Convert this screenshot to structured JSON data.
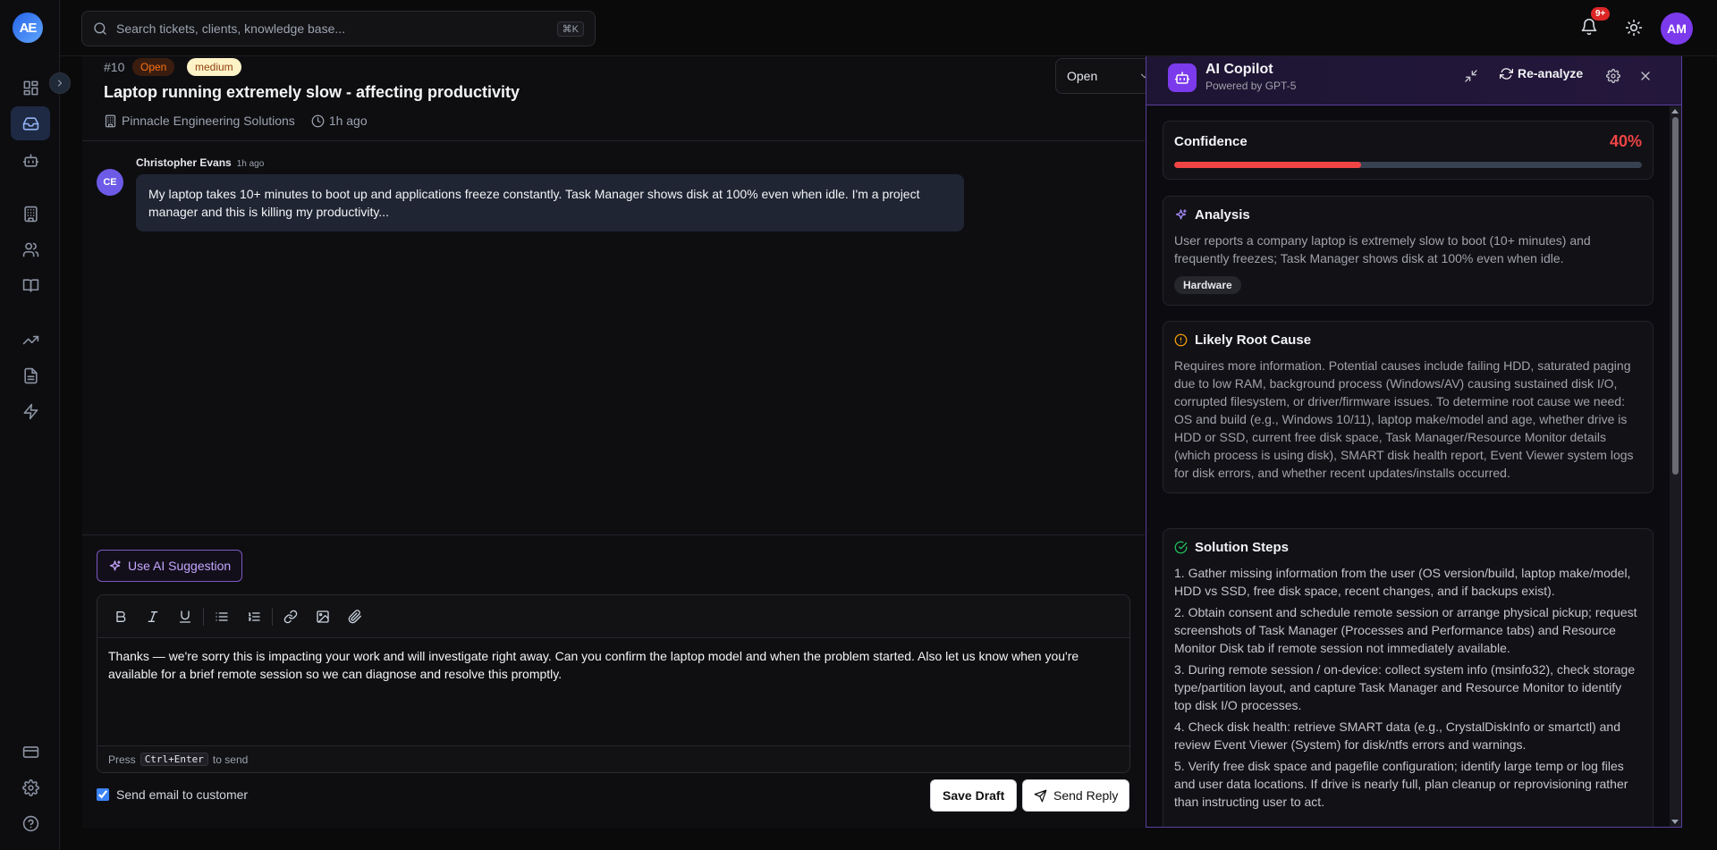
{
  "app": {
    "logo_text": "AE"
  },
  "search": {
    "placeholder": "Search tickets, clients, knowledge base...",
    "shortcut": "⌘K"
  },
  "header": {
    "notifications_badge": "9+",
    "user_initials": "AM"
  },
  "rail": {
    "items": [
      "dashboard-icon",
      "inbox-icon",
      "bot-icon",
      "building-icon",
      "users-icon",
      "book-icon",
      "trending-icon",
      "document-icon",
      "bolt-icon"
    ],
    "bottom": [
      "card-icon",
      "settings-icon",
      "help-icon"
    ]
  },
  "ticket": {
    "number": "#10",
    "status_badge": "Open",
    "priority_badge": "medium",
    "title": "Laptop running extremely slow - affecting productivity",
    "company": "Pinnacle Engineering Solutions",
    "age": "1h ago",
    "status_select": "Open",
    "message": {
      "initials": "CE",
      "author": "Christopher Evans",
      "time": "1h ago",
      "body": "My laptop takes 10+ minutes to boot up and applications freeze constantly. Task Manager shows disk at 100% even when idle. I'm a project manager and this is killing my productivity..."
    }
  },
  "composer": {
    "ai_suggestion_label": "Use AI Suggestion",
    "reply_text": "Thanks — we're sorry this is impacting your work and will investigate right away. Can you confirm the laptop model and when the problem started. Also let us know when you're available for a brief remote session so we can diagnose and resolve this promptly.",
    "hint_prefix": "Press",
    "hint_key": "Ctrl+Enter",
    "hint_suffix": "to send",
    "send_email_label": "Send email to customer",
    "send_email_checked": true,
    "save_draft_label": "Save Draft",
    "send_reply_label": "Send Reply"
  },
  "copilot": {
    "title": "AI Copilot",
    "subtitle": "Powered by GPT-5",
    "reanalyze_label": "Re-analyze",
    "confidence_label": "Confidence",
    "confidence_value": "40%",
    "confidence_fraction": 0.4,
    "analysis_title": "Analysis",
    "analysis_text": "User reports a company laptop is extremely slow to boot (10+ minutes) and frequently freezes; Task Manager shows disk at 100% even when idle.",
    "analysis_tag": "Hardware",
    "root_cause_title": "Likely Root Cause",
    "root_cause_text": "Requires more information. Potential causes include failing HDD, saturated paging due to low RAM, background process (Windows/AV) causing sustained disk I/O, corrupted filesystem, or driver/firmware issues. To determine root cause we need: OS and build (e.g., Windows 10/11), laptop make/model and age, whether drive is HDD or SSD, current free disk space, Task Manager/Resource Monitor details (which process is using disk), SMART disk health report, Event Viewer system logs for disk errors, and whether recent updates/installs occurred.",
    "solution_title": "Solution Steps",
    "steps": [
      "1. Gather missing information from the user (OS version/build, laptop make/model, HDD vs SSD, free disk space, recent changes, and if backups exist).",
      "2. Obtain consent and schedule remote session or arrange physical pickup; request screenshots of Task Manager (Processes and Performance tabs) and Resource Monitor Disk tab if remote session not immediately available.",
      "3. During remote session / on-device: collect system info (msinfo32), check storage type/partition layout, and capture Task Manager and Resource Monitor to identify top disk I/O processes.",
      "4. Check disk health: retrieve SMART data (e.g., CrystalDiskInfo or smartctl) and review Event Viewer (System) for disk/ntfs errors and warnings.",
      "5. Verify free disk space and pagefile configuration; identify large temp or log files and user data locations. If drive is nearly full, plan cleanup or reprovisioning rather than instructing user to act."
    ]
  },
  "colors": {
    "accent": "#7c3aed",
    "danger": "#ef4444",
    "brand": "#2563eb"
  }
}
